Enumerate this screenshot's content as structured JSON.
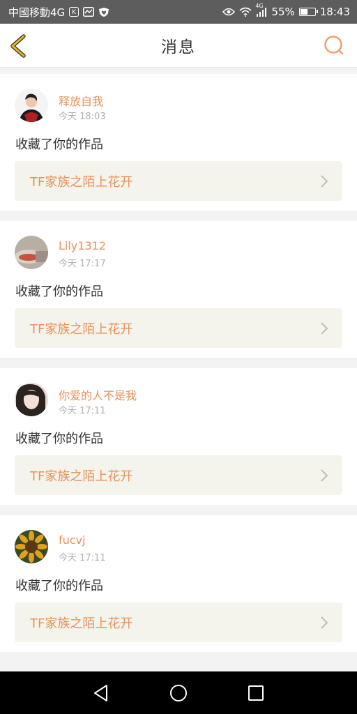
{
  "status_bar": {
    "carrier": "中國移動4G",
    "k_badge": "K",
    "icons": [
      "activity-icon",
      "heart-shield-icon",
      "eye-icon",
      "wifi-icon",
      "signal-icon"
    ],
    "network": "4G",
    "battery_percent": "55%",
    "battery_level": 0.55,
    "time": "18:43"
  },
  "header": {
    "title": "消息",
    "back_icon": "back-chevron-icon",
    "search_icon": "search-icon",
    "accent_color": "#e8b422",
    "search_color": "#f0a06a"
  },
  "messages": [
    {
      "username": "释放自我",
      "time": "今天 18:03",
      "action": "收藏了你的作品",
      "work_title": "TF家族之陌上花开"
    },
    {
      "username": "Lily1312",
      "time": "今天 17:17",
      "action": "收藏了你的作品",
      "work_title": "TF家族之陌上花开"
    },
    {
      "username": "你爱的人不是我",
      "time": "今天 17:11",
      "action": "收藏了你的作品",
      "work_title": "TF家族之陌上花开"
    },
    {
      "username": "fucvj",
      "time": "今天 17:11",
      "action": "收藏了你的作品",
      "work_title": "TF家族之陌上花开"
    }
  ],
  "colors": {
    "username": "#e8905a",
    "link_bg": "#f4f4ec",
    "text": "#333333",
    "muted": "#b0b0b0"
  },
  "nav_bar": {
    "icons": [
      "back-triangle-icon",
      "home-circle-icon",
      "recents-square-icon"
    ]
  }
}
